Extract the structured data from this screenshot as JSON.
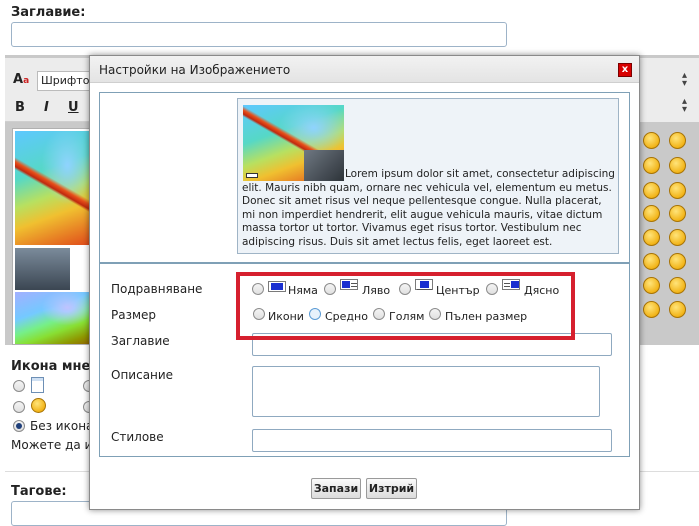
{
  "page": {
    "title_label": "Заглавие:",
    "icon_section_label": "Икона мнен",
    "no_icon_label": "Без икона",
    "icon_hint": "Можете да из",
    "tags_label": "Тагове:"
  },
  "editor": {
    "font_select": "Шрифтове",
    "bold": "B",
    "italic": "I",
    "underline": "U"
  },
  "modal": {
    "title": "Настройки на Изображението",
    "close_label": "x",
    "preview_text": "Lorem ipsum dolor sit amet, consectetur adipiscing elit. Mauris nibh quam, ornare nec vehicula vel, elementum eu metus. Donec sit amet risus vel neque pellentesque congue. Nulla placerat, mi non imperdiet hendrerit, elit augue vehicula mauris, vitae dictum massa tortor ut tortor. Vivamus eget risus tortor. Vestibulum nec adipiscing risus. Duis sit amet lectus felis, eget laoreet est.",
    "alignment": {
      "label": "Подравняване",
      "options": [
        "Няма",
        "Ляво",
        "Център",
        "Дясно"
      ]
    },
    "size": {
      "label": "Размер",
      "options": [
        "Икони",
        "Средно",
        "Голям",
        "Пълен размер"
      ],
      "selected": "Средно"
    },
    "title_field_label": "Заглавие",
    "description_label": "Описание",
    "styles_label": "Стилове",
    "save_button": "Запази",
    "delete_button": "Изтрий"
  },
  "colors": {
    "highlight": "#d6202e",
    "close_button": "#d80000",
    "panel_border": "#7fa0b6"
  }
}
